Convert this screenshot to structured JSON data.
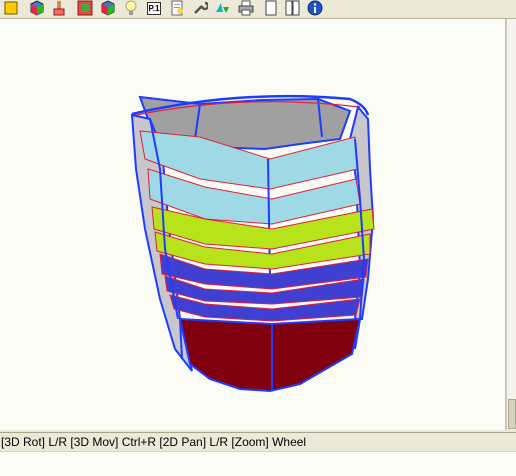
{
  "toolbar": {
    "buttons": [
      {
        "name": "color-cube-icon"
      },
      {
        "name": "paint-brush-icon"
      },
      {
        "name": "texture-panel-icon"
      },
      {
        "name": "color-cube-icon-2"
      },
      {
        "name": "light-bulb-icon"
      },
      {
        "name": "page-number-icon",
        "label": "P.1"
      },
      {
        "name": "page-setup-icon"
      },
      {
        "name": "wrench-icon"
      },
      {
        "name": "3d-arrow-icon"
      },
      {
        "name": "printer-icon"
      },
      {
        "name": "single-page-icon"
      },
      {
        "name": "double-page-icon"
      },
      {
        "name": "info-icon"
      }
    ]
  },
  "status": {
    "text": "[3D Rot] L/R [3D Mov] Ctrl+R [2D Pan] L/R [Zoom] Wheel"
  },
  "model": {
    "band_colors": {
      "interior": "#a0a0a0",
      "light_blue": "#9fd9e6",
      "yellow_green": "#b7e31a",
      "blue": "#3f3fd2",
      "dark_red": "#800010",
      "edge_blue": "#1e3cff",
      "edge_red": "#e0203a"
    }
  }
}
